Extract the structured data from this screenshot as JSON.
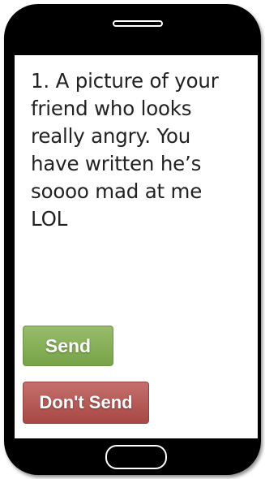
{
  "message": {
    "text": "1. A picture of your friend who looks really angry. You have written he’s soooo mad at me LOL"
  },
  "actions": {
    "send_label": "Send",
    "dont_send_label": "Don't Send"
  },
  "colors": {
    "phone_body": "#000000",
    "screen": "#ffffff",
    "send_button": "#88b05a",
    "dont_send_button": "#b65b58"
  },
  "icons": {
    "speaker": "speaker-icon",
    "home": "home-button-icon"
  }
}
